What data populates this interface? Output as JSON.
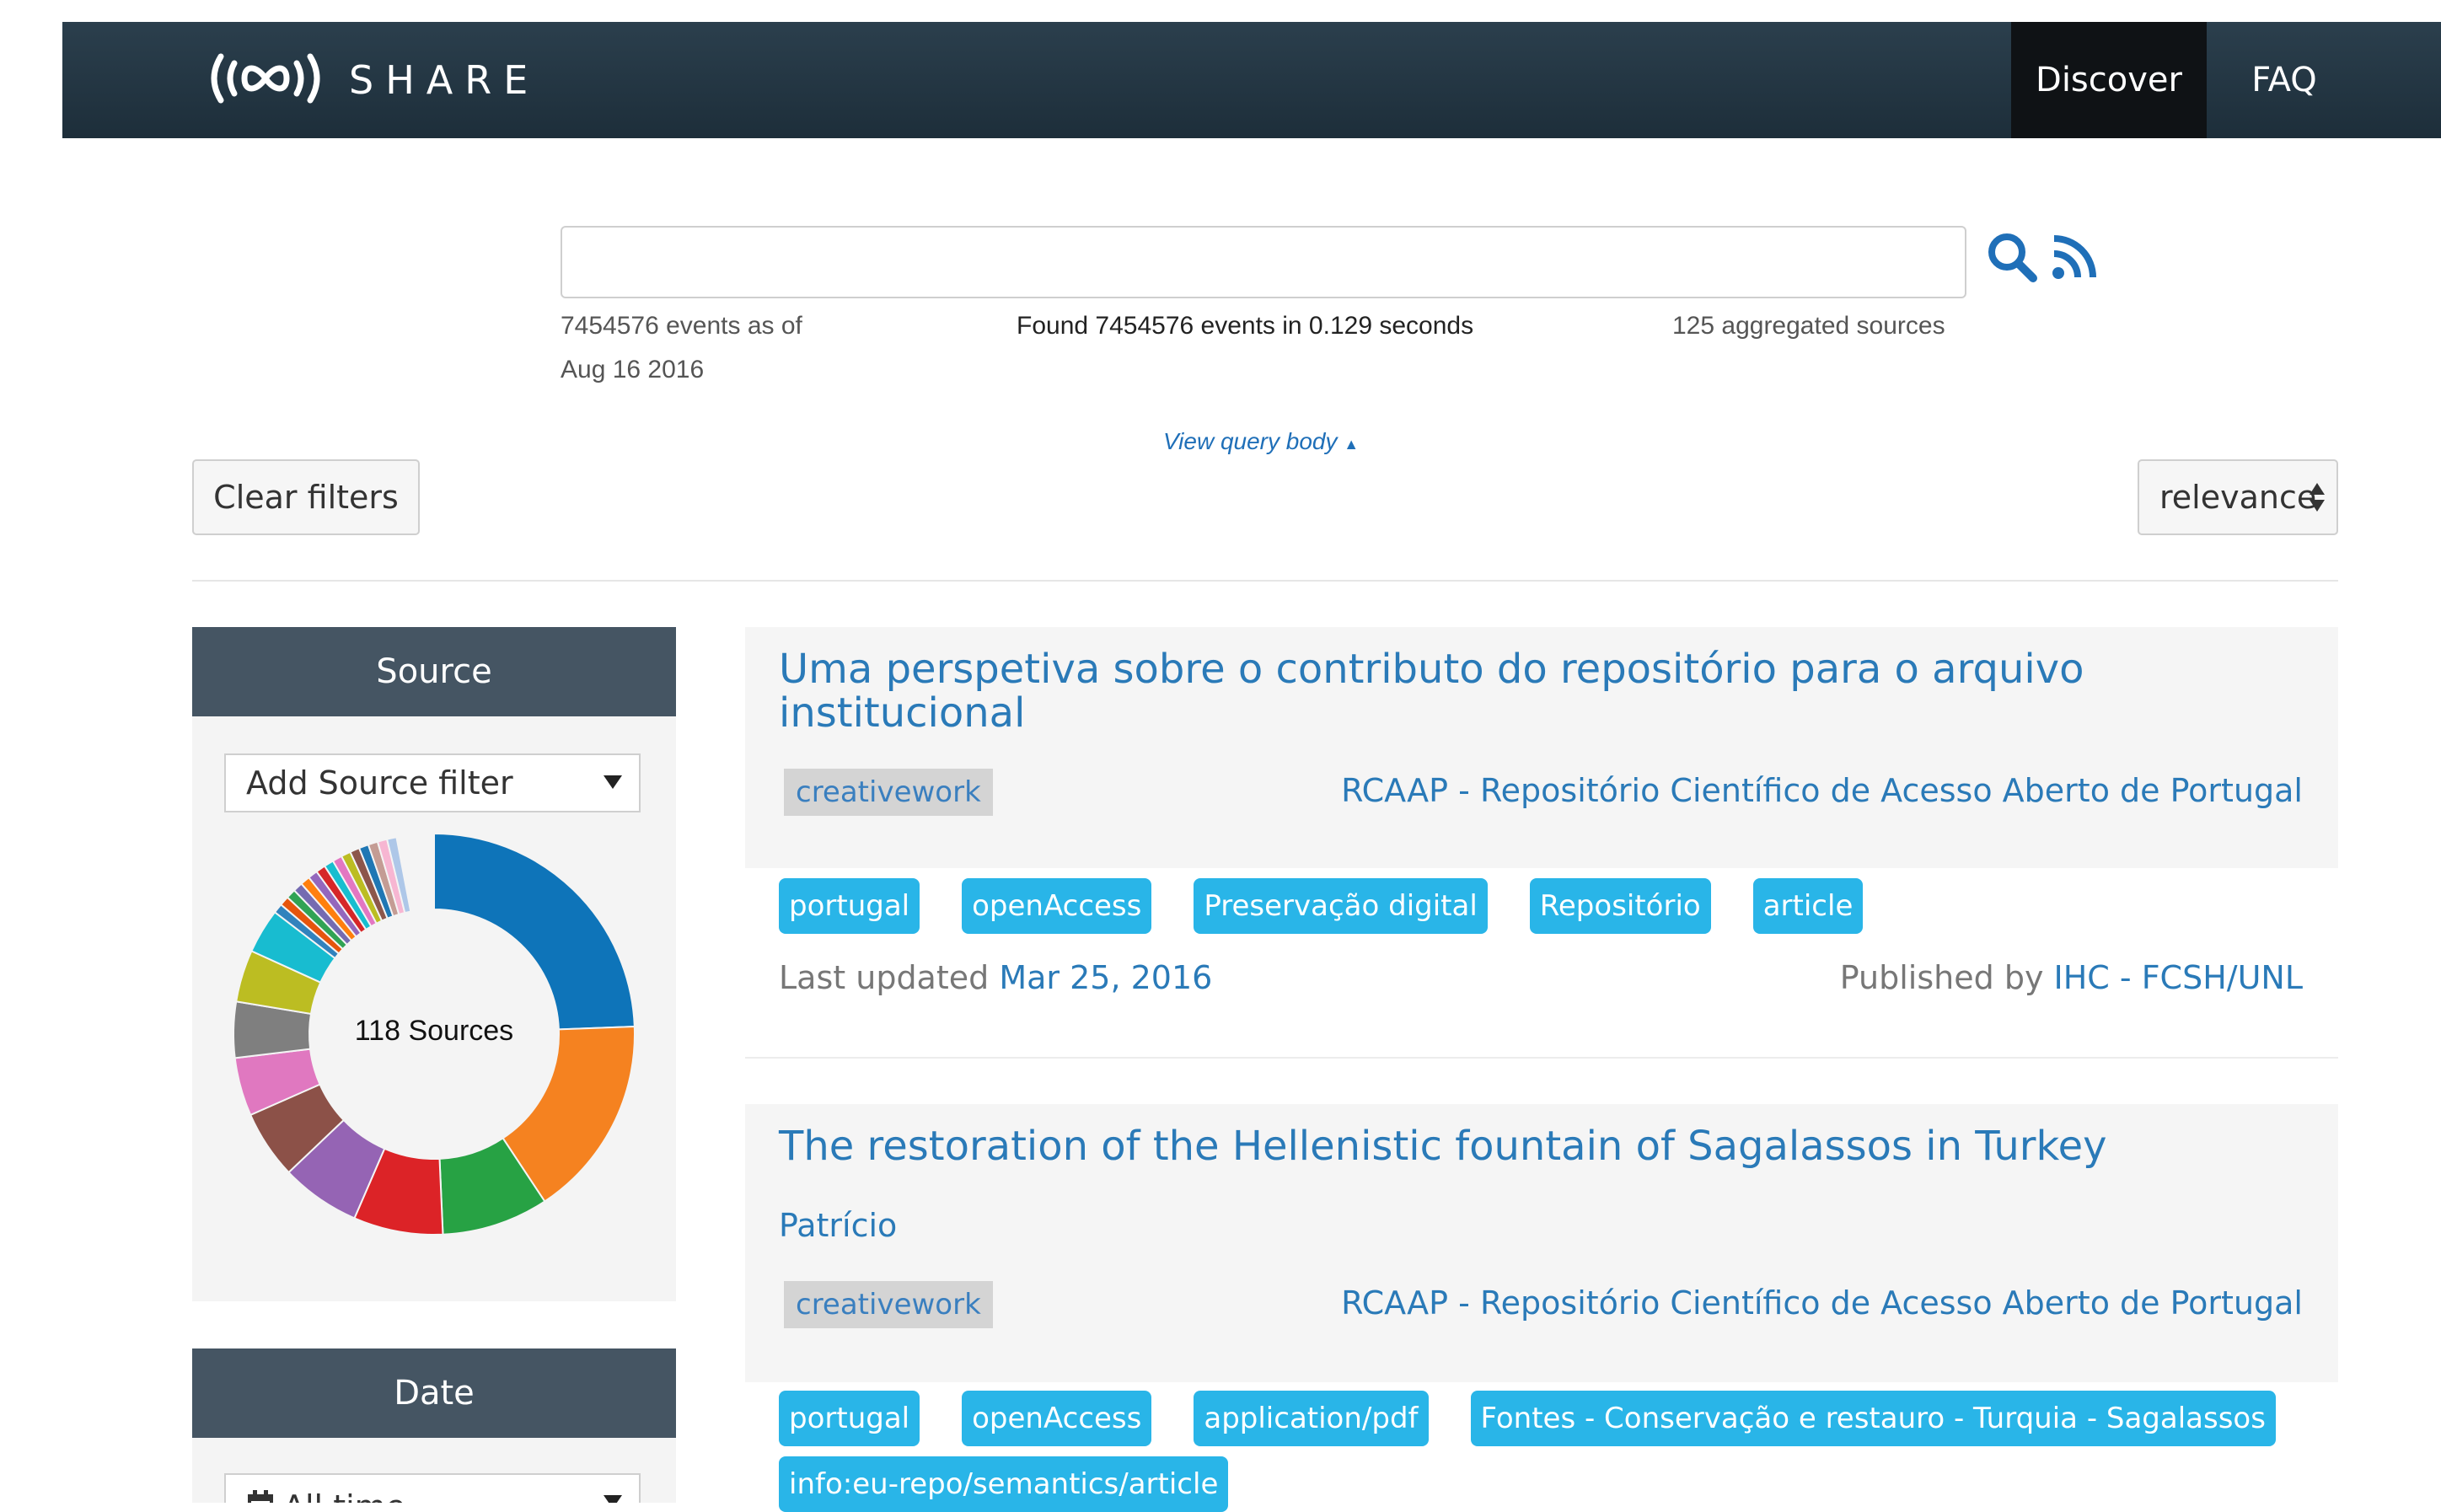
{
  "nav": {
    "brand": "SHARE",
    "items": [
      {
        "label": "Discover",
        "active": true
      },
      {
        "label": "FAQ",
        "active": false
      }
    ]
  },
  "search": {
    "value": "",
    "placeholder": "",
    "icons": [
      "search-icon",
      "rss-icon"
    ],
    "events_as_of_line1": "7454576 events as of",
    "events_as_of_line2": "Aug 16 2016",
    "found": "Found 7454576 events in 0.129 seconds",
    "sources": "125 aggregated sources",
    "view_query": "View query body"
  },
  "toolbar": {
    "clear_filters": "Clear filters",
    "sort": "relevance"
  },
  "sidebar": {
    "source": {
      "heading": "Source",
      "select": "Add Source filter",
      "donut_label": "118 Sources",
      "slice_colors": [
        "#0e74b9",
        "#f58220",
        "#27a244",
        "#dc2327",
        "#9564b4",
        "#8c5148",
        "#e078c0",
        "#7f7f7f",
        "#bcbd22",
        "#18bcd0"
      ]
    },
    "date": {
      "heading": "Date",
      "select": "All time"
    }
  },
  "results": [
    {
      "title": "Uma perspetiva sobre o contributo do repositório para o arquivo institucional",
      "type": "creativework",
      "provider": "RCAAP - Repositório Científico de Acesso Aberto de Portugal",
      "tags": [
        "portugal",
        "openAccess",
        "Preservação digital",
        "Repositório",
        "article"
      ],
      "updated_label": "Last updated ",
      "updated": "Mar 25, 2016",
      "published_label": "Published by ",
      "publisher": "IHC - FCSH/UNL"
    },
    {
      "title": "The restoration of the Hellenistic fountain of Sagalassos in Turkey",
      "author": "Patrício",
      "type": "creativework",
      "provider": "RCAAP - Repositório Científico de Acesso Aberto de Portugal",
      "tags": [
        "portugal",
        "openAccess",
        "application/pdf",
        "Fontes - Conservação e restauro - Turquia - Sagalassos",
        "info:eu-repo/semantics/article"
      ]
    }
  ]
}
